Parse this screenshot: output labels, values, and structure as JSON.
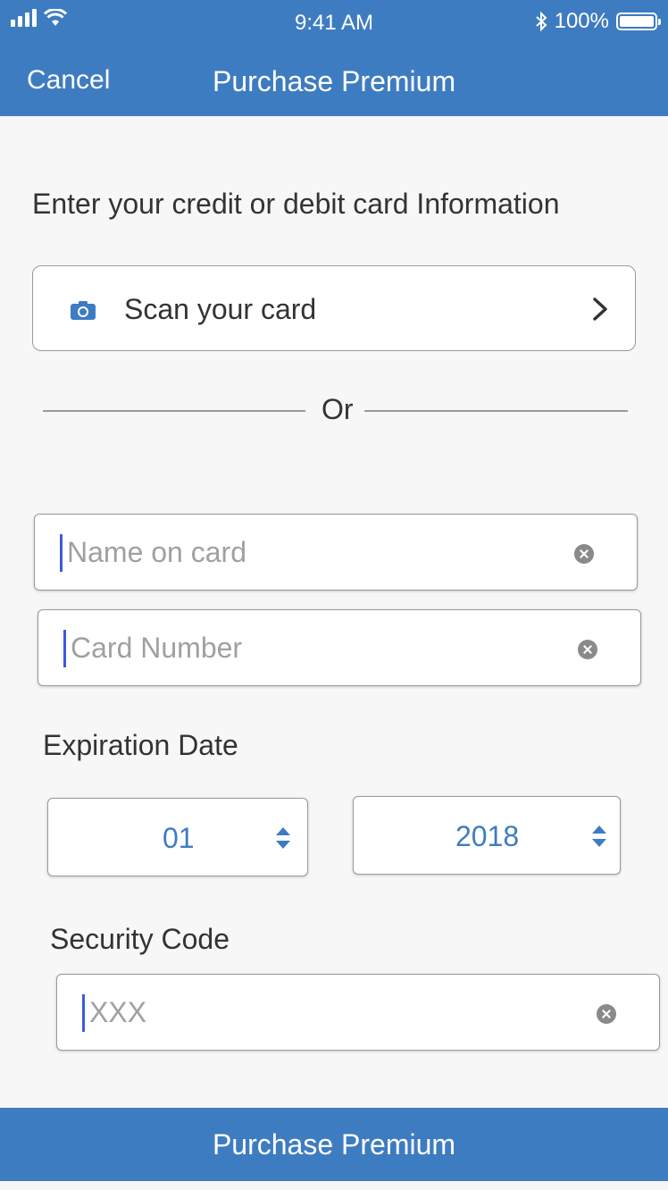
{
  "status_bar": {
    "time": "9:41 AM",
    "battery": "100%"
  },
  "nav": {
    "cancel_label": "Cancel",
    "title": "Purchase Premium"
  },
  "instructions": "Enter your credit or debit  card Information",
  "scan": {
    "label": "Scan your card",
    "icon": "camera-icon"
  },
  "divider": {
    "label": "Or"
  },
  "fields": {
    "name": {
      "placeholder": "Name on card",
      "value": ""
    },
    "card_number": {
      "placeholder": "Card Number",
      "value": ""
    },
    "security_code": {
      "placeholder": "XXX",
      "value": ""
    }
  },
  "expiration": {
    "label": "Expiration Date",
    "month": "01",
    "year": "2018"
  },
  "security": {
    "label": "Security Code"
  },
  "purchase_button": {
    "label": "Purchase Premium"
  },
  "colors": {
    "accent": "#3e7cc1",
    "caret": "#3b5bdb",
    "background": "#f7f7f7"
  }
}
